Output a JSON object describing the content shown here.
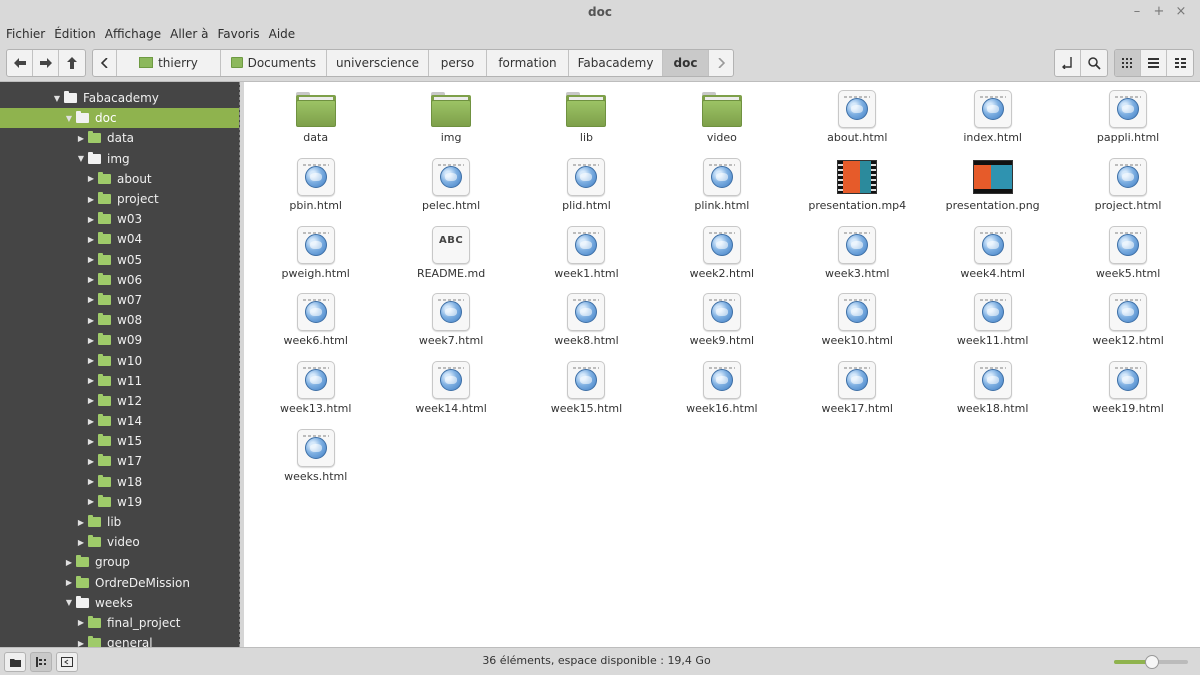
{
  "window": {
    "title": "doc",
    "controls": [
      "–",
      "+",
      "×"
    ]
  },
  "menu": [
    "Fichier",
    "Édition",
    "Affichage",
    "Aller à",
    "Favoris",
    "Aide"
  ],
  "breadcrumb": [
    "thierry",
    "Documents",
    "universcience",
    "perso",
    "formation",
    "Fabacademy",
    "doc"
  ],
  "breadcrumb_widths": [
    104,
    106,
    102,
    58,
    82,
    94,
    46
  ],
  "tree": [
    {
      "label": "Fabacademy",
      "indent": 52,
      "expanded": true,
      "selected": false,
      "green": false
    },
    {
      "label": "doc",
      "indent": 64,
      "expanded": true,
      "selected": true,
      "green": false
    },
    {
      "label": "data",
      "indent": 76,
      "expanded": false,
      "selected": false,
      "green": true
    },
    {
      "label": "img",
      "indent": 76,
      "expanded": true,
      "selected": false,
      "green": false
    },
    {
      "label": "about",
      "indent": 86,
      "expanded": false,
      "selected": false,
      "green": true
    },
    {
      "label": "project",
      "indent": 86,
      "expanded": false,
      "selected": false,
      "green": true
    },
    {
      "label": "w03",
      "indent": 86,
      "expanded": false,
      "selected": false,
      "green": true
    },
    {
      "label": "w04",
      "indent": 86,
      "expanded": false,
      "selected": false,
      "green": true
    },
    {
      "label": "w05",
      "indent": 86,
      "expanded": false,
      "selected": false,
      "green": true
    },
    {
      "label": "w06",
      "indent": 86,
      "expanded": false,
      "selected": false,
      "green": true
    },
    {
      "label": "w07",
      "indent": 86,
      "expanded": false,
      "selected": false,
      "green": true
    },
    {
      "label": "w08",
      "indent": 86,
      "expanded": false,
      "selected": false,
      "green": true
    },
    {
      "label": "w09",
      "indent": 86,
      "expanded": false,
      "selected": false,
      "green": true
    },
    {
      "label": "w10",
      "indent": 86,
      "expanded": false,
      "selected": false,
      "green": true
    },
    {
      "label": "w11",
      "indent": 86,
      "expanded": false,
      "selected": false,
      "green": true
    },
    {
      "label": "w12",
      "indent": 86,
      "expanded": false,
      "selected": false,
      "green": true
    },
    {
      "label": "w14",
      "indent": 86,
      "expanded": false,
      "selected": false,
      "green": true
    },
    {
      "label": "w15",
      "indent": 86,
      "expanded": false,
      "selected": false,
      "green": true
    },
    {
      "label": "w17",
      "indent": 86,
      "expanded": false,
      "selected": false,
      "green": true
    },
    {
      "label": "w18",
      "indent": 86,
      "expanded": false,
      "selected": false,
      "green": true
    },
    {
      "label": "w19",
      "indent": 86,
      "expanded": false,
      "selected": false,
      "green": true
    },
    {
      "label": "lib",
      "indent": 76,
      "expanded": false,
      "selected": false,
      "green": true
    },
    {
      "label": "video",
      "indent": 76,
      "expanded": false,
      "selected": false,
      "green": true
    },
    {
      "label": "group",
      "indent": 64,
      "expanded": false,
      "selected": false,
      "green": true
    },
    {
      "label": "OrdreDeMission",
      "indent": 64,
      "expanded": false,
      "selected": false,
      "green": true
    },
    {
      "label": "weeks",
      "indent": 64,
      "expanded": true,
      "selected": false,
      "green": false
    },
    {
      "label": "final_project",
      "indent": 76,
      "expanded": false,
      "selected": false,
      "green": true
    },
    {
      "label": "general",
      "indent": 76,
      "expanded": false,
      "selected": false,
      "green": true
    }
  ],
  "files": [
    {
      "name": "data",
      "type": "folder"
    },
    {
      "name": "img",
      "type": "folder"
    },
    {
      "name": "lib",
      "type": "folder"
    },
    {
      "name": "video",
      "type": "folder"
    },
    {
      "name": "about.html",
      "type": "html"
    },
    {
      "name": "index.html",
      "type": "html"
    },
    {
      "name": "pappli.html",
      "type": "html"
    },
    {
      "name": "pbin.html",
      "type": "html"
    },
    {
      "name": "pelec.html",
      "type": "html"
    },
    {
      "name": "plid.html",
      "type": "html"
    },
    {
      "name": "plink.html",
      "type": "html"
    },
    {
      "name": "presentation.mp4",
      "type": "mp4"
    },
    {
      "name": "presentation.png",
      "type": "png"
    },
    {
      "name": "project.html",
      "type": "html"
    },
    {
      "name": "pweigh.html",
      "type": "html"
    },
    {
      "name": "README.md",
      "type": "text",
      "icon_text": "ABC"
    },
    {
      "name": "week1.html",
      "type": "html"
    },
    {
      "name": "week2.html",
      "type": "html"
    },
    {
      "name": "week3.html",
      "type": "html"
    },
    {
      "name": "week4.html",
      "type": "html"
    },
    {
      "name": "week5.html",
      "type": "html"
    },
    {
      "name": "week6.html",
      "type": "html"
    },
    {
      "name": "week7.html",
      "type": "html"
    },
    {
      "name": "week8.html",
      "type": "html"
    },
    {
      "name": "week9.html",
      "type": "html"
    },
    {
      "name": "week10.html",
      "type": "html"
    },
    {
      "name": "week11.html",
      "type": "html"
    },
    {
      "name": "week12.html",
      "type": "html"
    },
    {
      "name": "week13.html",
      "type": "html"
    },
    {
      "name": "week14.html",
      "type": "html"
    },
    {
      "name": "week15.html",
      "type": "html"
    },
    {
      "name": "week16.html",
      "type": "html"
    },
    {
      "name": "week17.html",
      "type": "html"
    },
    {
      "name": "week18.html",
      "type": "html"
    },
    {
      "name": "week19.html",
      "type": "html"
    },
    {
      "name": "weeks.html",
      "type": "html"
    }
  ],
  "status": {
    "text": "36 éléments, espace disponible : 19,4 Go",
    "zoom_level": 0.52
  },
  "colors": {
    "accent": "#8fb34e",
    "sidebar_bg": "#454545",
    "folder_green": "#7ea04a"
  },
  "icons": {
    "back": "arrow-left-icon",
    "forward": "arrow-right-icon",
    "up": "arrow-up-icon",
    "location_toggle": "chevron-left-icon",
    "crumb_next": "chevron-right-icon",
    "terminal": "terminal-icon",
    "search": "search-icon",
    "view_icons": "grid-view-icon",
    "view_list": "list-view-icon",
    "view_compact": "compact-view-icon"
  }
}
